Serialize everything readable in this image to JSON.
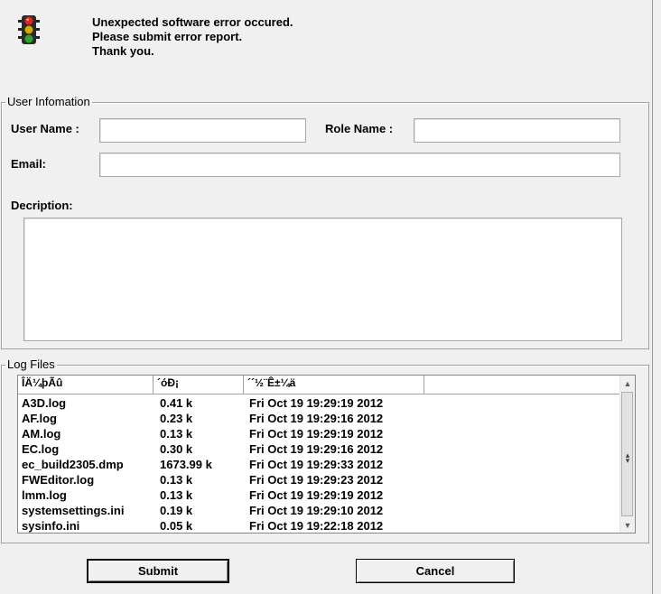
{
  "message": {
    "line1": "Unexpected software error occured.",
    "line2": "Please submit error report.",
    "line3": "Thank you."
  },
  "user_info": {
    "group_title": "User Infomation",
    "user_name_label": "User Name :",
    "user_name_value": "",
    "role_name_label": "Role Name :",
    "role_name_value": "",
    "email_label": "Email:",
    "email_value": "",
    "description_label": "Decription:",
    "description_value": ""
  },
  "log_files": {
    "group_title": "Log Files",
    "columns": [
      "ÎÄ¼þÃû",
      "´óÐ¡",
      "´´½¨Ê±¼ä"
    ],
    "rows": [
      {
        "name": "A3D.log",
        "size": "0.41 k",
        "date": "Fri Oct 19 19:29:19 2012"
      },
      {
        "name": "AF.log",
        "size": "0.23 k",
        "date": "Fri Oct 19 19:29:16 2012"
      },
      {
        "name": "AM.log",
        "size": "0.13 k",
        "date": "Fri Oct 19 19:29:19 2012"
      },
      {
        "name": "EC.log",
        "size": "0.30 k",
        "date": "Fri Oct 19 19:29:16 2012"
      },
      {
        "name": "ec_build2305.dmp",
        "size": "1673.99 k",
        "date": "Fri Oct 19 19:29:33 2012"
      },
      {
        "name": "FWEditor.log",
        "size": "0.13 k",
        "date": "Fri Oct 19 19:29:23 2012"
      },
      {
        "name": "lmm.log",
        "size": "0.13 k",
        "date": "Fri Oct 19 19:29:19 2012"
      },
      {
        "name": "systemsettings.ini",
        "size": "0.19 k",
        "date": "Fri Oct 19 19:29:10 2012"
      },
      {
        "name": "sysinfo.ini",
        "size": "0.05 k",
        "date": "Fri Oct 19 19:22:18 2012"
      }
    ]
  },
  "buttons": {
    "submit": "Submit",
    "cancel": "Cancel"
  },
  "icon": "traffic-light-icon"
}
